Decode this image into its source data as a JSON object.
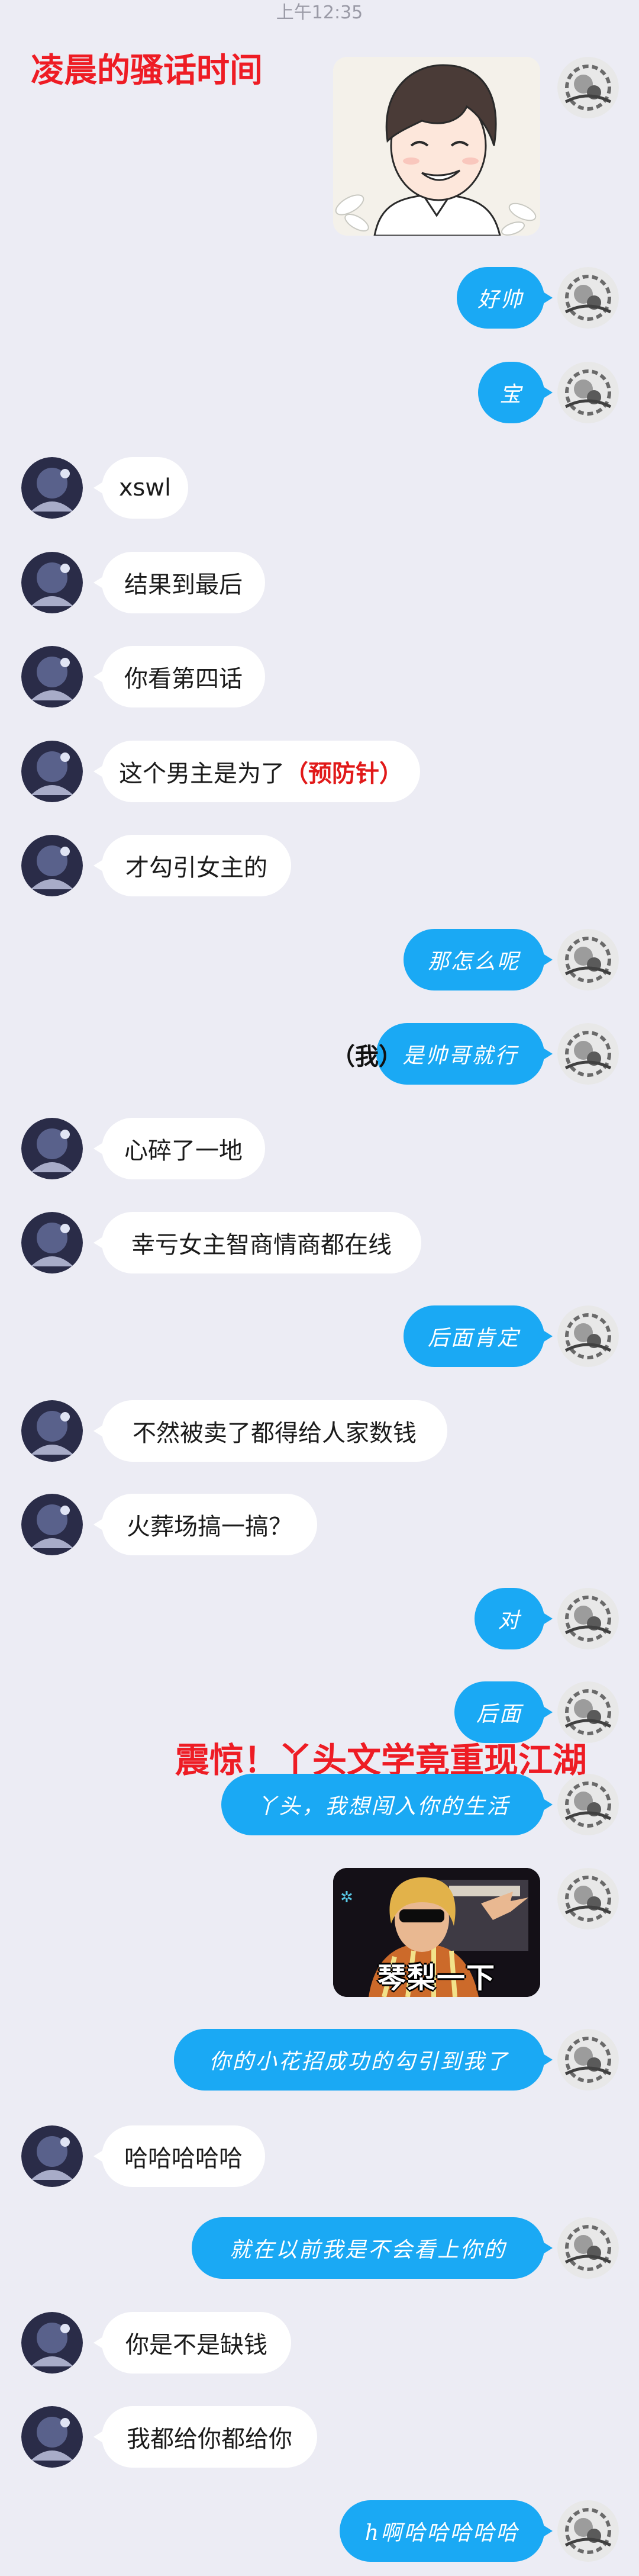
{
  "status_bar": {
    "time": "上午12:35"
  },
  "captions": {
    "section1": "凌晨的骚话时间",
    "section2": "震惊！丫头文学竟重现江湖"
  },
  "colors": {
    "background": "#ececf4",
    "outgoing_bubble": "#1aa9f4",
    "incoming_bubble": "#ffffff",
    "caption_red": "#ee1c24"
  },
  "messages": [
    {
      "side": "out",
      "type": "image",
      "subject": "smiling anime boy"
    },
    {
      "side": "out",
      "text": "好帅"
    },
    {
      "side": "out",
      "text": "宝"
    },
    {
      "side": "in",
      "text": "xswl"
    },
    {
      "side": "in",
      "text": "结果到最后"
    },
    {
      "side": "in",
      "text": "你看第四话"
    },
    {
      "side": "in",
      "text": "这个男主是为了",
      "highlight": "（预防针）"
    },
    {
      "side": "in",
      "text": "才勾引女主的"
    },
    {
      "side": "out",
      "text": "那怎么呢"
    },
    {
      "side": "out",
      "prefix": "（我）",
      "text": "是帅哥就行"
    },
    {
      "side": "in",
      "text": "心碎了一地"
    },
    {
      "side": "in",
      "text": "幸亏女主智商情商都在线"
    },
    {
      "side": "out",
      "text": "后面肯定"
    },
    {
      "side": "in",
      "text": "不然被卖了都得给人家数钱"
    },
    {
      "side": "in",
      "text": "火葬场搞一搞？"
    },
    {
      "side": "out",
      "text": "对"
    },
    {
      "side": "out",
      "text": "后面"
    },
    {
      "side": "out",
      "text": "丫头，我想闯入你的生活"
    },
    {
      "side": "out",
      "type": "sticker",
      "caption": "琴梨一下"
    },
    {
      "side": "out",
      "text": "你的小花招成功的勾引到我了"
    },
    {
      "side": "in",
      "text": "哈哈哈哈哈"
    },
    {
      "side": "out",
      "text": "就在以前我是不会看上你的"
    },
    {
      "side": "in",
      "text": "你是不是缺钱"
    },
    {
      "side": "in",
      "text": "我都给你都给你"
    },
    {
      "side": "out",
      "text": "h啊哈哈哈哈哈"
    }
  ]
}
